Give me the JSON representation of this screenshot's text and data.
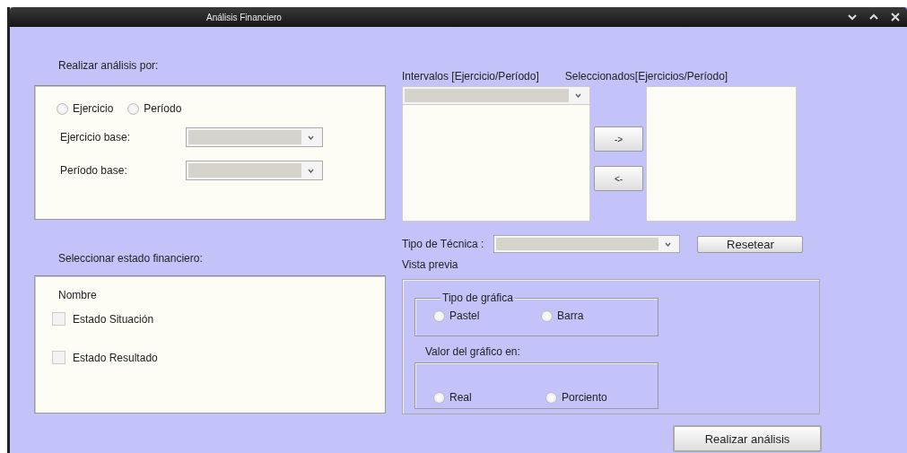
{
  "window": {
    "title": "Análisis Financiero"
  },
  "analysis_by": {
    "label": "Realizar análisis por:",
    "options": [
      {
        "label": "Ejercicio",
        "selected": false
      },
      {
        "label": "Período",
        "selected": false
      }
    ],
    "fields": [
      {
        "label": "Ejercicio base:"
      },
      {
        "label": "Período base:"
      }
    ]
  },
  "statement": {
    "label": "Seleccionar estado financiero:",
    "column": "Nombre",
    "items": [
      {
        "label": "Estado Situación",
        "checked": false
      },
      {
        "label": "Estado Resultado",
        "checked": false
      }
    ]
  },
  "intervals": {
    "label": "Intervalos [Ejercicio/Período]"
  },
  "selected_list": {
    "label": "Seleccionados[Ejercicios/Período]"
  },
  "move_buttons": [
    "->",
    "<-"
  ],
  "technique": {
    "label": "Tipo de Técnica :",
    "reset_button": "Resetear"
  },
  "preview": {
    "label": "Vista previa",
    "chart_type": {
      "label": "Tipo de gráfica",
      "options": [
        {
          "label": "Pastel",
          "selected": false
        },
        {
          "label": "Barra",
          "selected": false
        }
      ]
    },
    "value_in": {
      "label": "Valor del gráfico en:",
      "options": [
        {
          "label": "Real",
          "selected": false
        },
        {
          "label": "Porciento",
          "selected": false
        }
      ]
    }
  },
  "run_button": "Realizar análisis"
}
